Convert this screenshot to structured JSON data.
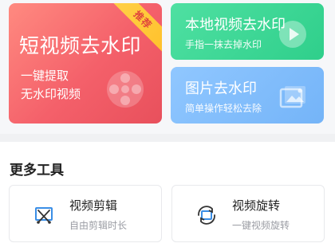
{
  "feature_cards": {
    "main": {
      "title": "短视频去水印",
      "line1": "一键提取",
      "line2": "无水印视频",
      "badge": "推荐",
      "icon": "film-reel-icon",
      "colors": {
        "start": "#ff8a80",
        "end": "#e8505c",
        "badge": "#ffc02a"
      }
    },
    "local_video": {
      "title": "本地视频去水印",
      "subtitle": "手指一抹去掉水印",
      "icon": "play-icon",
      "color": "#2fcf8b"
    },
    "image": {
      "title": "图片去水印",
      "subtitle": "简单操作轻松去除",
      "icon": "image-icon",
      "color": "#74b4f8"
    }
  },
  "more_tools": {
    "title": "更多工具",
    "items": [
      {
        "title": "视频剪辑",
        "subtitle": "自由剪辑时长",
        "icon": "video-crop-icon"
      },
      {
        "title": "视频旋转",
        "subtitle": "一键视频旋转",
        "icon": "rotate-icon"
      }
    ]
  }
}
